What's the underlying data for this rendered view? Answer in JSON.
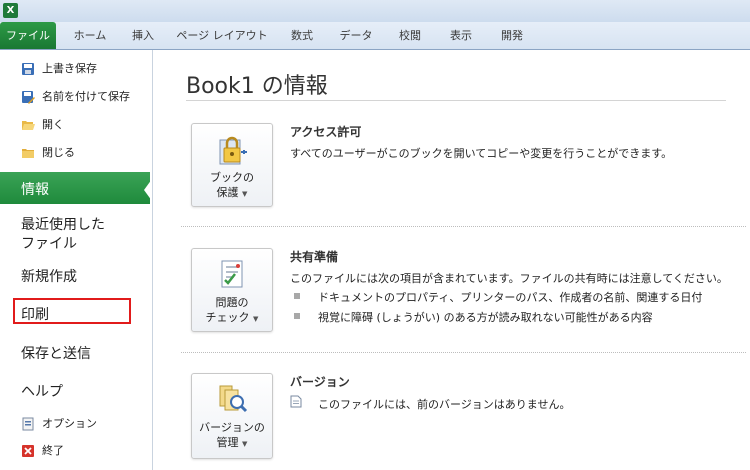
{
  "ribbon": {
    "tabs": [
      "ファイル",
      "ホーム",
      "挿入",
      "ページ レイアウト",
      "数式",
      "データ",
      "校閲",
      "表示",
      "開発"
    ]
  },
  "sidebar": {
    "commands_top": [
      "上書き保存",
      "名前を付けて保存",
      "開く",
      "閉じる"
    ],
    "nav": {
      "info": "情報",
      "recent_line1": "最近使用した",
      "recent_line2": "ファイル",
      "new": "新規作成",
      "print": "印刷",
      "save_send": "保存と送信",
      "help": "ヘルプ"
    },
    "commands_bottom": [
      "オプション",
      "終了"
    ]
  },
  "main": {
    "title": "Book1 の情報",
    "permissions": {
      "button_line1": "ブックの",
      "button_line2": "保護",
      "heading": "アクセス許可",
      "text": "すべてのユーザーがこのブックを開いてコピーや変更を行うことができます。"
    },
    "prepare": {
      "button_line1": "問題の",
      "button_line2": "チェック",
      "heading": "共有準備",
      "text": "このファイルには次の項目が含まれています。ファイルの共有時には注意してください。",
      "items": [
        "ドキュメントのプロパティ、プリンターのパス、作成者の名前、関連する日付",
        "視覚に障碍 (しょうがい) のある方が読み取れない可能性がある内容"
      ]
    },
    "versions": {
      "button_line1": "バージョンの",
      "button_line2": "管理",
      "heading": "バージョン",
      "text": "このファイルには、前のバージョンはありません。"
    }
  },
  "colors": {
    "file_tab": "#1f8a3c",
    "active_nav": "#2e9a4a",
    "highlight_box": "#e11b1b"
  },
  "icons": [
    "excel-app-icon",
    "save-icon",
    "save-as-icon",
    "open-folder-icon",
    "close-folder-icon",
    "options-icon",
    "exit-icon",
    "protect-workbook-icon",
    "check-issues-icon",
    "manage-versions-icon",
    "version-file-icon"
  ]
}
